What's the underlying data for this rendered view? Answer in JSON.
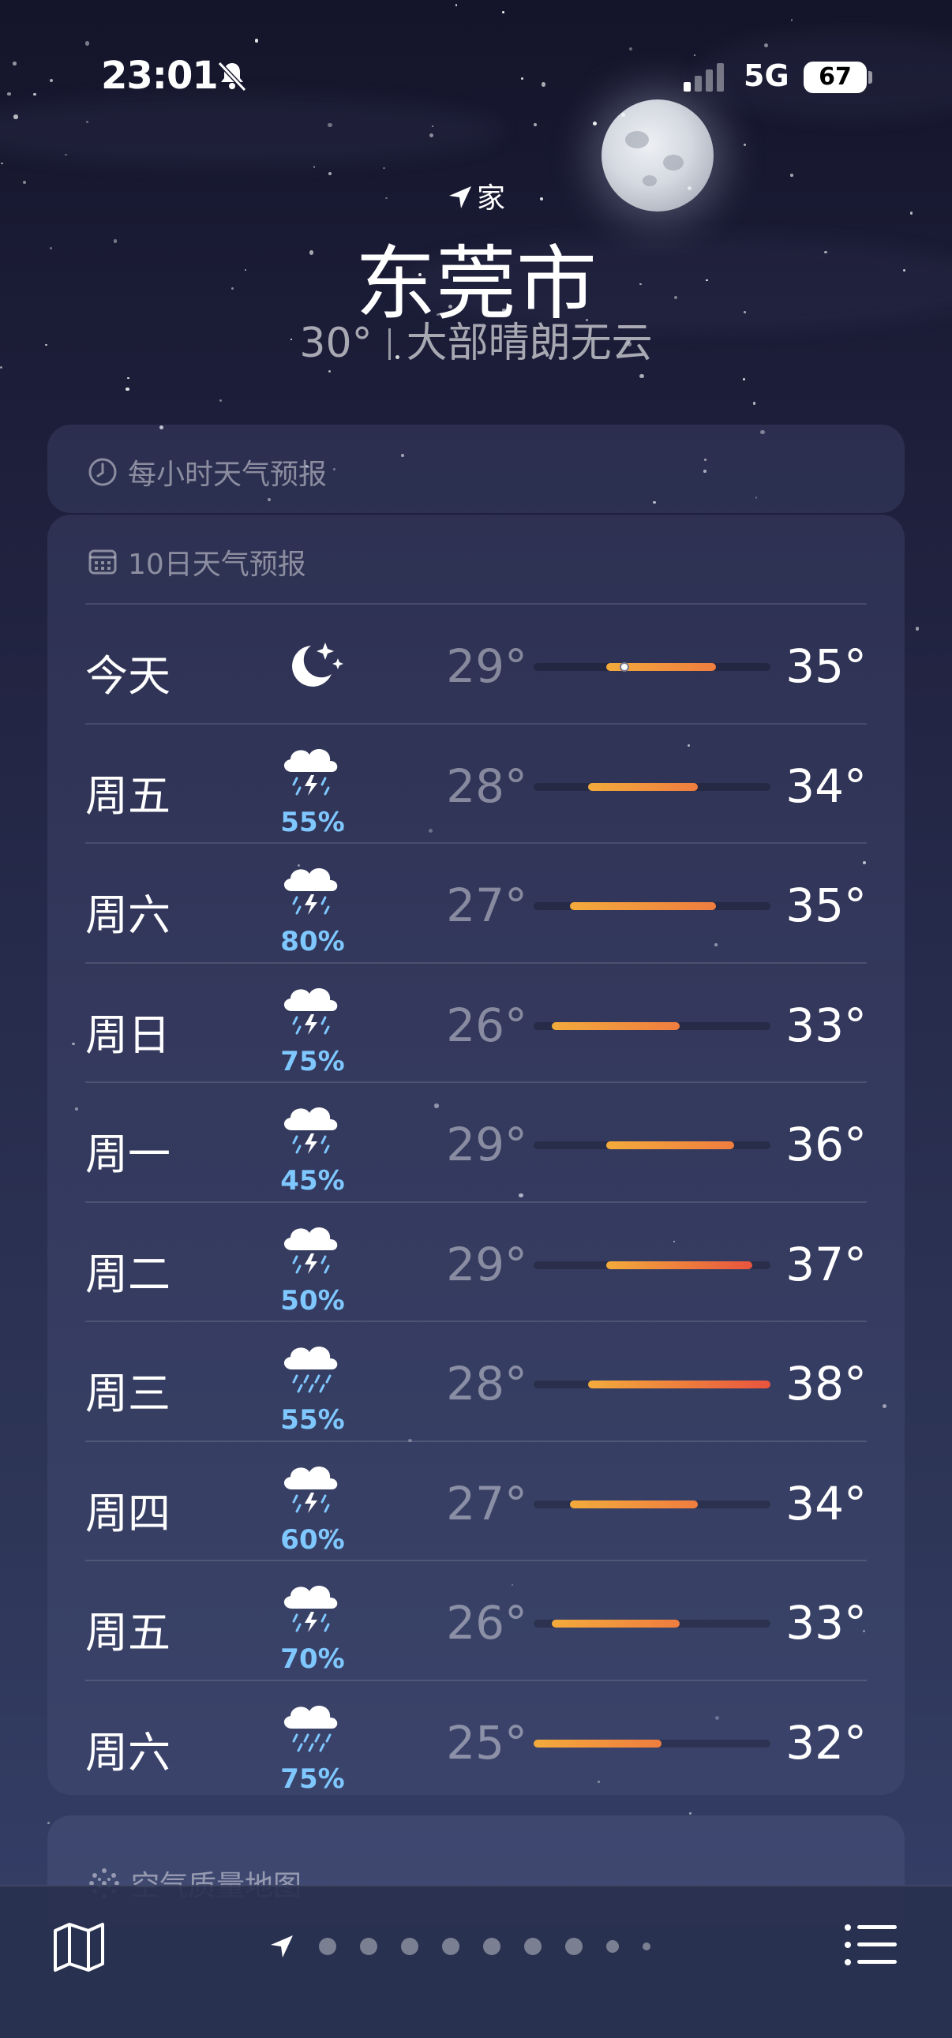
{
  "status_bar": {
    "time": "23:01",
    "network": "5G",
    "battery": "67"
  },
  "header": {
    "location_label": "家",
    "city": "东莞市",
    "current_temp": "30°",
    "condition": "大部晴朗无云"
  },
  "hourly_card": {
    "title": "每小时天气预报"
  },
  "daily_card": {
    "title": "10日天气预报",
    "days": [
      {
        "day": "今天",
        "icon": "moon-stars-icon",
        "precip": "",
        "low": "29°",
        "high": "35°"
      },
      {
        "day": "周五",
        "icon": "thunderstorm-rain-icon",
        "precip": "55%",
        "low": "28°",
        "high": "34°"
      },
      {
        "day": "周六",
        "icon": "thunderstorm-rain-icon",
        "precip": "80%",
        "low": "27°",
        "high": "35°"
      },
      {
        "day": "周日",
        "icon": "thunderstorm-rain-icon",
        "precip": "75%",
        "low": "26°",
        "high": "33°"
      },
      {
        "day": "周一",
        "icon": "thunderstorm-rain-icon",
        "precip": "45%",
        "low": "29°",
        "high": "36°"
      },
      {
        "day": "周二",
        "icon": "thunderstorm-rain-icon",
        "precip": "50%",
        "low": "29°",
        "high": "37°"
      },
      {
        "day": "周三",
        "icon": "cloud-rain-icon",
        "precip": "55%",
        "low": "28°",
        "high": "38°"
      },
      {
        "day": "周四",
        "icon": "thunderstorm-rain-icon",
        "precip": "60%",
        "low": "27°",
        "high": "34°"
      },
      {
        "day": "周五",
        "icon": "thunderstorm-rain-icon",
        "precip": "70%",
        "low": "26°",
        "high": "33°"
      },
      {
        "day": "周六",
        "icon": "cloud-rain-icon",
        "precip": "75%",
        "low": "25°",
        "high": "32°"
      }
    ]
  },
  "air_quality_card": {
    "title": "空气质量地图"
  },
  "bottom_bar": {
    "map_icon": "map-icon",
    "list_icon": "list-icon",
    "page_count": 9
  },
  "colors": {
    "range_cool": "#f3ab3c",
    "range_warm": "#ef7d3f",
    "range_hot": "#e8543e",
    "precip": "#7fc8ff"
  }
}
